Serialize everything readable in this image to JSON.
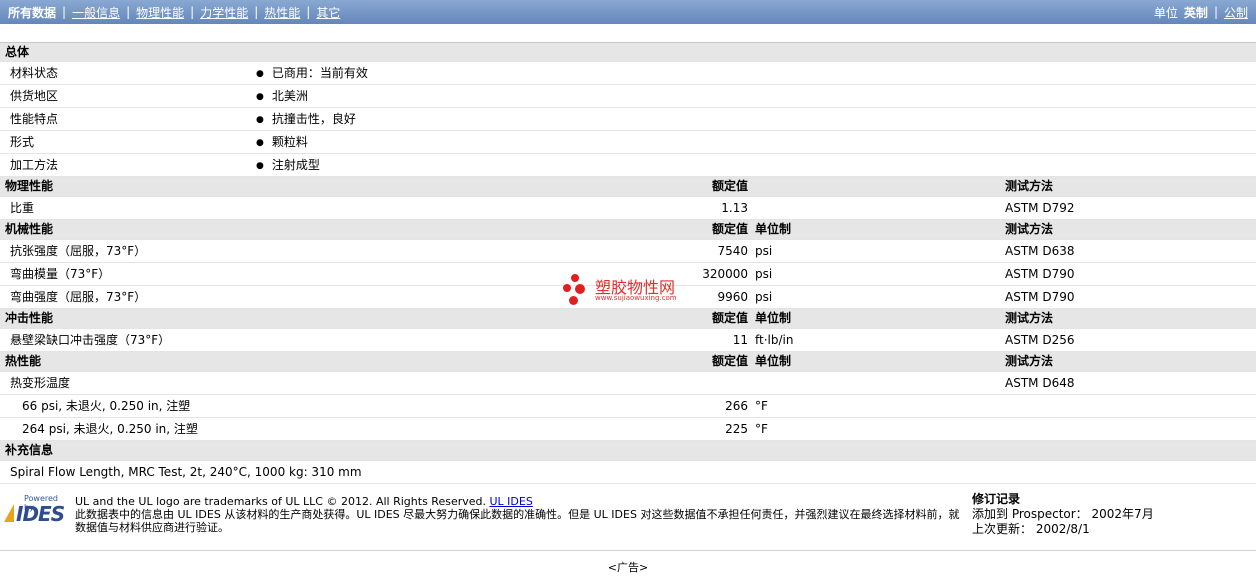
{
  "nav": {
    "items": [
      "所有数据",
      "一般信息",
      "物理性能",
      "力学性能",
      "热性能",
      "其它"
    ],
    "units_label": "单位",
    "units_current": "英制",
    "units_alt": "公制"
  },
  "general": {
    "title": "总体",
    "rows": [
      {
        "name": "材料状态",
        "value": "已商用：当前有效"
      },
      {
        "name": "供货地区",
        "value": "北美洲"
      },
      {
        "name": "性能特点",
        "value": "抗撞击性，良好"
      },
      {
        "name": "形式",
        "value": "颗粒料"
      },
      {
        "name": "加工方法",
        "value": "注射成型"
      }
    ]
  },
  "physical": {
    "title": "物理性能",
    "col_value": "额定值",
    "col_method": "测试方法",
    "rows": [
      {
        "name": "比重",
        "value": "1.13",
        "unit": "",
        "method": "ASTM D792"
      }
    ]
  },
  "mechanical": {
    "title": "机械性能",
    "col_value": "额定值",
    "col_unit": "单位制",
    "col_method": "测试方法",
    "rows": [
      {
        "name": "抗张强度（屈服，73°F）",
        "value": "7540",
        "unit": "psi",
        "method": "ASTM D638"
      },
      {
        "name": "弯曲模量（73°F）",
        "value": "320000",
        "unit": "psi",
        "method": "ASTM D790"
      },
      {
        "name": "弯曲强度（屈服，73°F）",
        "value": "9960",
        "unit": "psi",
        "method": "ASTM D790"
      }
    ]
  },
  "impact": {
    "title": "冲击性能",
    "col_value": "额定值",
    "col_unit": "单位制",
    "col_method": "测试方法",
    "rows": [
      {
        "name": "悬壁梁缺口冲击强度（73°F）",
        "value": "11",
        "unit": "ft·lb/in",
        "method": "ASTM D256"
      }
    ]
  },
  "thermal": {
    "title": "热性能",
    "col_value": "额定值",
    "col_unit": "单位制",
    "col_method": "测试方法",
    "parent": {
      "name": "热变形温度",
      "method": "ASTM D648"
    },
    "rows": [
      {
        "name": "66 psi, 未退火, 0.250 in, 注塑",
        "value": "266",
        "unit": "°F"
      },
      {
        "name": "264 psi, 未退火, 0.250 in, 注塑",
        "value": "225",
        "unit": "°F"
      }
    ]
  },
  "extra": {
    "title": "补充信息",
    "text": "Spiral Flow Length, MRC Test, 2t, 240°C, 1000 kg: 310 mm"
  },
  "footer": {
    "powered_by": "Powered by",
    "logo_text": "IDES",
    "trademark": "UL and the UL logo are trademarks of UL LLC © 2012. All Rights Reserved.",
    "link": "UL IDES",
    "disclaimer": "此数据表中的信息由 UL IDES 从该材料的生产商处获得。UL IDES 尽最大努力确保此数据的准确性。但是 UL IDES 对这些数据值不承担任何责任，并强烈建议在最终选择材料前，就数据值与材料供应商进行验证。",
    "revision_title": "修订记录",
    "added_label": "添加到 Prospector：",
    "added_value": "2002年7月",
    "updated_label": "上次更新：",
    "updated_value": "2002/8/1",
    "ad": "<广告>"
  },
  "watermark": {
    "text": "塑胶物性网",
    "url": "www.sujiaowuxing.com"
  },
  "colors": {
    "topbar": "#7295c3",
    "section_bg": "#e6e6e6",
    "watermark": "#e02020"
  }
}
